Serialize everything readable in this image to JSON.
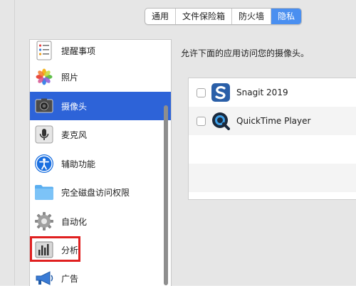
{
  "tabs": [
    "通用",
    "文件保险箱",
    "防火墙",
    "隐私"
  ],
  "active_tab": "隐私",
  "sidebar": {
    "items": [
      {
        "label": "提醒事项",
        "icon": "reminders-icon"
      },
      {
        "label": "照片",
        "icon": "photos-icon"
      },
      {
        "label": "摄像头",
        "icon": "camera-icon",
        "selected": true
      },
      {
        "label": "麦克风",
        "icon": "microphone-icon"
      },
      {
        "label": "辅助功能",
        "icon": "accessibility-icon"
      },
      {
        "label": "完全磁盘访问权限",
        "icon": "folder-icon"
      },
      {
        "label": "自动化",
        "icon": "gear-icon"
      },
      {
        "label": "分析",
        "icon": "analytics-icon"
      },
      {
        "label": "广告",
        "icon": "megaphone-icon"
      }
    ]
  },
  "main": {
    "description": "允许下面的应用访问您的摄像头。",
    "apps": [
      {
        "name": "Snagit 2019",
        "checked": false,
        "icon": "snagit-icon"
      },
      {
        "name": "QuickTime Player",
        "checked": false,
        "icon": "quicktime-icon"
      }
    ]
  },
  "colors": {
    "accent": "#4a8ff0",
    "selection": "#2d63d8",
    "highlight_box": "#e02020"
  }
}
